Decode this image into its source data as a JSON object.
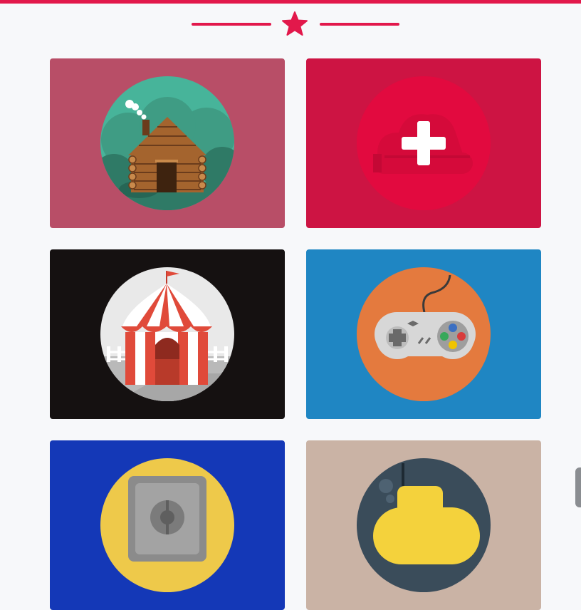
{
  "colors": {
    "accent": "#e2184b",
    "page_background": "#f7f8fa",
    "scroll_handle": "#8a8d91"
  },
  "header": {
    "divider_icon": "star-icon"
  },
  "gallery": {
    "cards": [
      {
        "name": "log-cabin-icon",
        "background": "#b84e67",
        "circle": "#47b49a"
      },
      {
        "name": "add-cloud-icon",
        "background": "#cd1443",
        "circle": "#e20a3f"
      },
      {
        "name": "circus-tent-icon",
        "background": "#151111",
        "circle": "#e9e9e9"
      },
      {
        "name": "game-controller-icon",
        "background": "#1f86c3",
        "circle": "#e47a3e"
      },
      {
        "name": "safe-icon",
        "background": "#1438b7",
        "circle": "#eec94a"
      },
      {
        "name": "submarine-icon",
        "background": "#cab3a5",
        "circle": "#3a4c5a"
      }
    ]
  }
}
